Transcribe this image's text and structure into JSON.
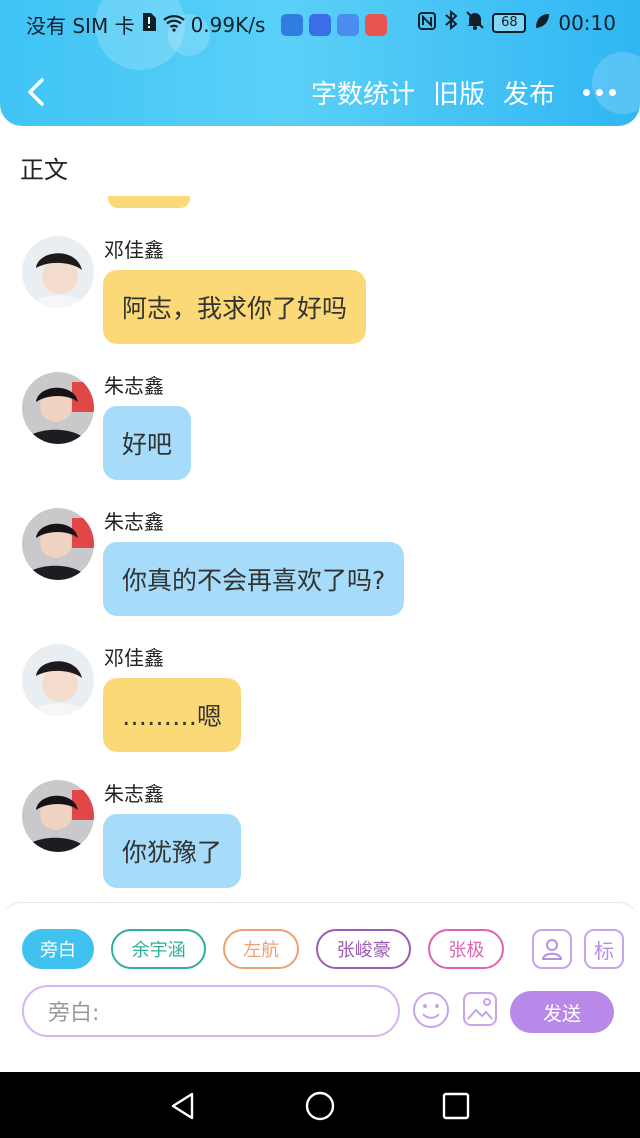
{
  "status_bar": {
    "carrier": "没有 SIM 卡",
    "network_speed": "0.99K/s",
    "battery": "68",
    "time": "00:10"
  },
  "nav": {
    "actions": [
      "字数统计",
      "旧版",
      "发布"
    ]
  },
  "section_title": "正文",
  "messages": [
    {
      "sender": "邓佳鑫",
      "text": "阿志，我求你了好吗",
      "color": "#fcd977"
    },
    {
      "sender": "朱志鑫",
      "text": "好吧",
      "color": "#a6dcfa"
    },
    {
      "sender": "朱志鑫",
      "text": "你真的不会再喜欢了吗?",
      "color": "#a6dcfa"
    },
    {
      "sender": "邓佳鑫",
      "text": "………嗯",
      "color": "#fcd977"
    },
    {
      "sender": "朱志鑫",
      "text": "你犹豫了",
      "color": "#a6dcfa"
    }
  ],
  "composer": {
    "roles": [
      "旁白",
      "余宇涵",
      "左航",
      "张峻豪",
      "张极"
    ],
    "mark_label": "标",
    "placeholder": "旁白:",
    "send_label": "发送"
  },
  "colors": {
    "header": "#3fc4f6",
    "accent_purple": "#b889e8"
  }
}
